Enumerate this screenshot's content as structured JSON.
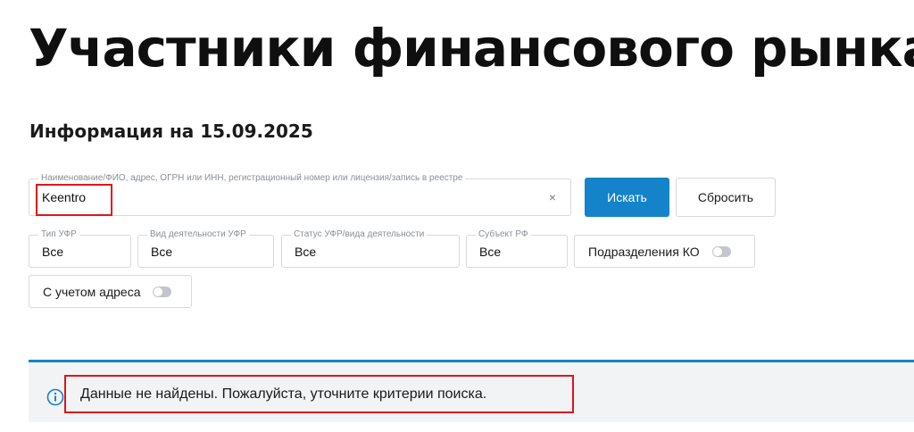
{
  "page": {
    "title": "Участники финансового рынка",
    "info_date": "Информация на 15.09.2025"
  },
  "search": {
    "label": "Наименование/ФИО, адрес, ОГРН или ИНН, регистрационный номер или лицензия/запись в реестре",
    "value": "Keentro",
    "clear_icon": "×",
    "submit_label": "Искать",
    "reset_label": "Сбросить"
  },
  "filters": {
    "type": {
      "label": "Тип УФР",
      "value": "Все"
    },
    "activity": {
      "label": "Вид деятельности УФР",
      "value": "Все"
    },
    "status": {
      "label": "Статус УФР/вида деятельности",
      "value": "Все"
    },
    "region": {
      "label": "Субъект РФ",
      "value": "Все"
    }
  },
  "toggles": {
    "ko_units": {
      "label": "Подразделения КО",
      "on": false
    },
    "with_address": {
      "label": "С учетом адреса",
      "on": false
    }
  },
  "alert": {
    "icon": "info-icon",
    "message": "Данные не найдены. Пожалуйста, уточните критерии поиска."
  },
  "colors": {
    "accent": "#1583c9",
    "highlight": "#e0151b",
    "alert_bg": "#f1f3f5"
  }
}
